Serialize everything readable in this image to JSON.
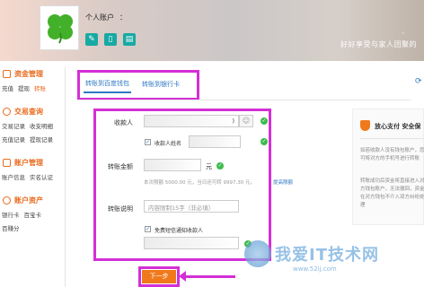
{
  "header": {
    "account_label": "个人账户",
    "account_colon": "：",
    "slogan_top": "，",
    "slogan": "好好享受与家人团聚的",
    "icons": [
      "edit-icon",
      "phone-icon",
      "card-icon"
    ]
  },
  "sidebar": {
    "sections": [
      {
        "title": "资金管理",
        "links": [
          "充值",
          "提现",
          "转账"
        ],
        "active": "转账"
      },
      {
        "title": "交易查询",
        "links": [
          "交易记录",
          "收支明细",
          "充值记录",
          "提现记录"
        ]
      },
      {
        "title": "账户管理",
        "links": [
          "账户信息",
          "实名认证"
        ]
      },
      {
        "title": "账户资产",
        "links": [
          "银行卡",
          "百宝卡",
          "百赚分"
        ]
      }
    ]
  },
  "tabs": {
    "to_wallet": "转账到百度钱包",
    "to_bank": "转账到银行卡"
  },
  "form": {
    "payee_label": "收款人",
    "payee_value": ")",
    "payee_name_checkbox": "收款人姓名",
    "amount_label": "转账金额",
    "amount_unit": "元",
    "amount_hint": "本次限额 5000.00 元，当日还可转 9997.30 元，",
    "amount_link": "提高限额",
    "note_label": "转账说明",
    "note_placeholder": "内容限制15字（非必填）",
    "sms_checkbox": "免费短信通知收款人",
    "submit": "下一步"
  },
  "right_panel": {
    "title": "放心支付  安全保",
    "text1": "如若收款人没有钱包账户，您可将对方的手机号进行转账",
    "text2": "转账成功后资金将直接进入对方钱包账户，无法撤回，资金在对方钱包不介入双方纠纷处理"
  },
  "watermark": {
    "text": "我爱IT技术网",
    "url": "www.52ij.com"
  },
  "colors": {
    "highlight": "#d42fd6",
    "accent": "#e96b1f",
    "link": "#2f78c4",
    "ok": "#3dbb4b",
    "button": "#f07a1b"
  }
}
